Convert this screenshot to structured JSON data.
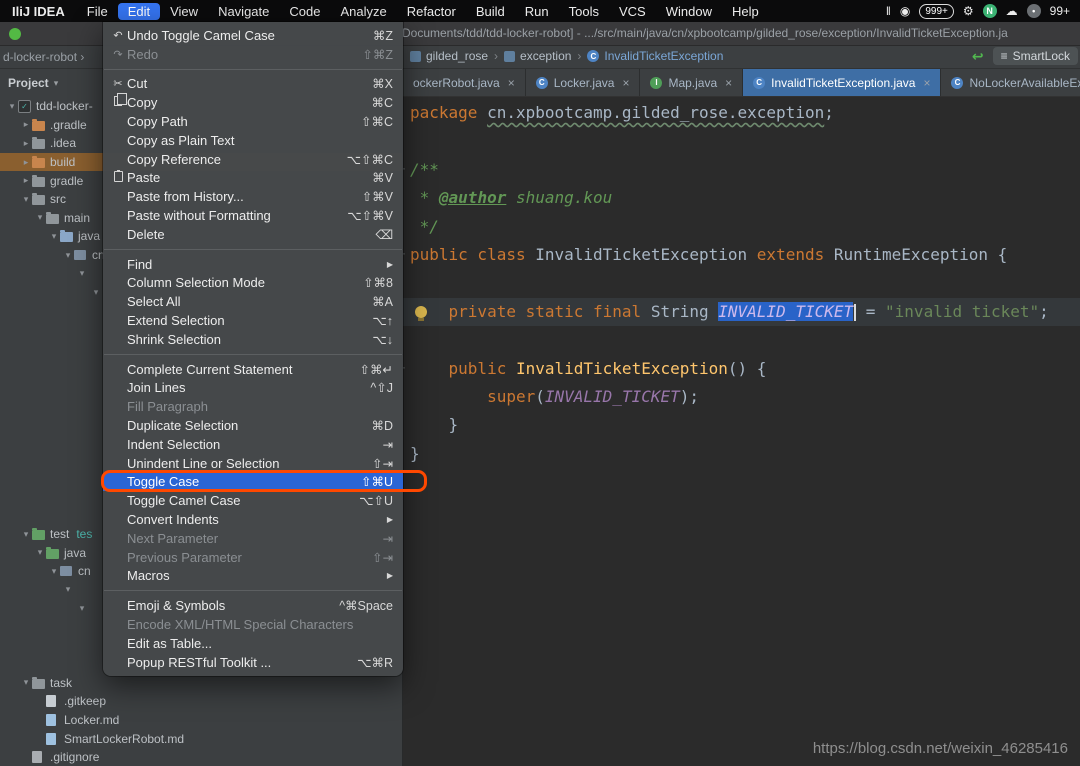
{
  "menubar": {
    "app_name": "IliJ IDEA",
    "menus": [
      "File",
      "Edit",
      "View",
      "Navigate",
      "Code",
      "Analyze",
      "Refactor",
      "Build",
      "Run",
      "Tools",
      "VCS",
      "Window",
      "Help"
    ],
    "active": "Edit",
    "status": [
      {
        "name": "pause-icon",
        "glyph": "‖"
      },
      {
        "name": "record-icon",
        "glyph": "◉"
      },
      {
        "name": "notification-badge-999",
        "glyph": "999+",
        "pill": true
      },
      {
        "name": "wrench-icon",
        "glyph": "⚙"
      },
      {
        "name": "n-circle-icon",
        "letter": "N",
        "circle": "#3bb273"
      },
      {
        "name": "cloud-icon",
        "glyph": "☁"
      },
      {
        "name": "chat-icon",
        "letter": "•",
        "circle": "#6b6f73"
      },
      {
        "name": "count-badge-99",
        "glyph": "99+"
      }
    ]
  },
  "window": {
    "title": "Documents/tdd/tdd-locker-robot] - .../src/main/java/cn/xpbootcamp/gilded_rose/exception/InvalidTicketException.ja"
  },
  "breadcrumbs": {
    "left_fragment": "d-locker-robot  ›",
    "items": [
      {
        "label": "gilded_rose",
        "icon": "package"
      },
      {
        "label": "exception",
        "icon": "package"
      },
      {
        "label": "InvalidTicketException",
        "icon": "class"
      }
    ]
  },
  "toolbar": {
    "green_arrow_glyph": "↩",
    "chip_icon": "≡",
    "chip_label": "SmartLock"
  },
  "project_panel": {
    "header": "Project",
    "header_caret": "▾",
    "rows": [
      {
        "label": "tdd-locker-",
        "indent": 0,
        "chevron": "open",
        "icon": "project"
      },
      {
        "label": ".gradle",
        "indent": 1,
        "chevron": "closed",
        "icon": "folder-excluded"
      },
      {
        "label": ".idea",
        "indent": 1,
        "chevron": "closed",
        "icon": "folder"
      },
      {
        "label": "build",
        "indent": 1,
        "chevron": "closed",
        "icon": "folder-excluded",
        "highlight": true
      },
      {
        "label": "gradle",
        "indent": 1,
        "chevron": "closed",
        "icon": "folder"
      },
      {
        "label": "src",
        "indent": 1,
        "chevron": "open",
        "icon": "folder"
      },
      {
        "label": "main",
        "indent": 2,
        "chevron": "open",
        "icon": "folder"
      },
      {
        "label": "java",
        "indent": 3,
        "chevron": "open",
        "icon": "folder-source"
      },
      {
        "label": "cn",
        "indent": 4,
        "chevron": "open",
        "icon": "package"
      },
      {
        "label": "",
        "indent": 5,
        "chevron": "open"
      },
      {
        "label": "",
        "indent": 6,
        "chevron": "open"
      },
      {
        "spacer": 12
      },
      {
        "label": "test",
        "indent": 1,
        "chevron": "open",
        "icon": "folder-test",
        "suffix": "tes"
      },
      {
        "label": "java",
        "indent": 2,
        "chevron": "open",
        "icon": "folder-test"
      },
      {
        "label": "cn",
        "indent": 3,
        "chevron": "open",
        "icon": "package"
      },
      {
        "label": "",
        "indent": 4,
        "chevron": "open"
      },
      {
        "label": "",
        "indent": 5,
        "chevron": "open"
      },
      {
        "spacer": 3
      },
      {
        "label": "task",
        "indent": 1,
        "chevron": "open",
        "icon": "folder"
      },
      {
        "label": ".gitkeep",
        "indent": 2,
        "icon": "file"
      },
      {
        "label": "Locker.md",
        "indent": 2,
        "icon": "file-md"
      },
      {
        "label": "SmartLockerRobot.md",
        "indent": 2,
        "icon": "file-md"
      },
      {
        "label": ".gitignore",
        "indent": 1,
        "icon": "file-git"
      }
    ]
  },
  "editor": {
    "tabs": [
      {
        "label": "ockerRobot.java",
        "close": true
      },
      {
        "label": "Locker.java",
        "icon": "class",
        "close": true
      },
      {
        "label": "Map.java",
        "icon": "interface",
        "close": true
      },
      {
        "label": "InvalidTicketException.java",
        "icon": "class",
        "close": true,
        "active": true
      },
      {
        "label": "NoLockerAvailableException..",
        "icon": "class"
      }
    ],
    "code_lines": [
      {
        "tokens": [
          {
            "t": "package ",
            "c": "kw"
          },
          {
            "t": "cn.xpbootcamp.gilded_rose.exception",
            "c": "pkg"
          },
          {
            "t": ";",
            "c": "pl"
          }
        ]
      },
      {
        "tokens": []
      },
      {
        "fold": true,
        "tokens": [
          {
            "t": "/**",
            "c": "doc"
          }
        ]
      },
      {
        "tokens": [
          {
            "t": " * ",
            "c": "doc"
          },
          {
            "t": "@author",
            "c": "doctag"
          },
          {
            "t": " shuang.kou",
            "c": "doc"
          }
        ]
      },
      {
        "tokens": [
          {
            "t": " */",
            "c": "doc"
          }
        ]
      },
      {
        "fold": true,
        "tokens": [
          {
            "t": "public class ",
            "c": "kw"
          },
          {
            "t": "InvalidTicketException ",
            "c": "pl"
          },
          {
            "t": "extends ",
            "c": "kw"
          },
          {
            "t": "RuntimeException ",
            "c": "pl"
          },
          {
            "t": "{",
            "c": "pl"
          }
        ]
      },
      {
        "tokens": []
      },
      {
        "highlight": true,
        "bulb": true,
        "tokens": [
          {
            "t": "    ",
            "c": "pl"
          },
          {
            "t": "private static final ",
            "c": "kw"
          },
          {
            "t": "String ",
            "c": "pl"
          },
          {
            "t": "INVALID_TICKET",
            "c": "const-sel",
            "caret": true
          },
          {
            "t": " = ",
            "c": "pl"
          },
          {
            "t": "\"invalid ticket\"",
            "c": "str"
          },
          {
            "t": ";",
            "c": "pl"
          }
        ]
      },
      {
        "tokens": []
      },
      {
        "fold": true,
        "tokens": [
          {
            "t": "    ",
            "c": "pl"
          },
          {
            "t": "public ",
            "c": "kw"
          },
          {
            "t": "InvalidTicketException",
            "c": "method"
          },
          {
            "t": "() {",
            "c": "pl"
          }
        ]
      },
      {
        "tokens": [
          {
            "t": "        ",
            "c": "pl"
          },
          {
            "t": "super",
            "c": "kw"
          },
          {
            "t": "(",
            "c": "pl"
          },
          {
            "t": "INVALID_TICKET",
            "c": "const"
          },
          {
            "t": ")",
            "c": "pl"
          },
          {
            "t": ";",
            "c": "pl"
          }
        ]
      },
      {
        "tokens": [
          {
            "t": "    }",
            "c": "pl"
          }
        ]
      },
      {
        "tokens": [
          {
            "t": "}",
            "c": "pl"
          }
        ]
      }
    ]
  },
  "edit_menu": {
    "items": [
      {
        "label": "Undo Toggle Camel Case",
        "shortcut": "⌘Z",
        "icon": "undo-icon"
      },
      {
        "label": "Redo",
        "shortcut": "⇧⌘Z",
        "icon": "redo-icon",
        "disabled": true
      },
      {
        "separator": true
      },
      {
        "label": "Cut",
        "shortcut": "⌘X",
        "icon": "cut-icon"
      },
      {
        "label": "Copy",
        "shortcut": "⌘C",
        "icon": "copy-icon"
      },
      {
        "label": "Copy Path",
        "shortcut": "⇧⌘C"
      },
      {
        "label": "Copy as Plain Text"
      },
      {
        "label": "Copy Reference",
        "shortcut": "⌥⇧⌘C"
      },
      {
        "label": "Paste",
        "shortcut": "⌘V",
        "icon": "paste-icon"
      },
      {
        "label": "Paste from History...",
        "shortcut": "⇧⌘V"
      },
      {
        "label": "Paste without Formatting",
        "shortcut": "⌥⇧⌘V"
      },
      {
        "label": "Delete",
        "shortcut": "⌫"
      },
      {
        "separator": true
      },
      {
        "label": "Find",
        "submenu": true
      },
      {
        "label": "Column Selection Mode",
        "shortcut": "⇧⌘8"
      },
      {
        "label": "Select All",
        "shortcut": "⌘A"
      },
      {
        "label": "Extend Selection",
        "shortcut": "⌥↑"
      },
      {
        "label": "Shrink Selection",
        "shortcut": "⌥↓"
      },
      {
        "separator": true
      },
      {
        "label": "Complete Current Statement",
        "shortcut": "⇧⌘↵"
      },
      {
        "label": "Join Lines",
        "shortcut": "^⇧J"
      },
      {
        "label": "Fill Paragraph",
        "disabled": true
      },
      {
        "label": "Duplicate Selection",
        "shortcut": "⌘D"
      },
      {
        "label": "Indent Selection",
        "shortcut": "⇥"
      },
      {
        "label": "Unindent Line or Selection",
        "shortcut": "⇧⇥"
      },
      {
        "label": "Toggle Case",
        "shortcut": "⇧⌘U",
        "selected": true,
        "annotated": true
      },
      {
        "label": "Toggle Camel Case",
        "shortcut": "⌥⇧U"
      },
      {
        "label": "Convert Indents",
        "submenu": true
      },
      {
        "label": "Next Parameter",
        "shortcut": "⇥",
        "disabled": true
      },
      {
        "label": "Previous Parameter",
        "shortcut": "⇧⇥",
        "disabled": true
      },
      {
        "label": "Macros",
        "submenu": true
      },
      {
        "separator": true
      },
      {
        "label": "Emoji & Symbols",
        "shortcut": "^⌘Space"
      },
      {
        "label": "Encode XML/HTML Special Characters",
        "disabled": true
      },
      {
        "label": "Edit as Table..."
      },
      {
        "label": "Popup RESTful Toolkit ...",
        "shortcut": "⌥⌘R"
      }
    ]
  },
  "watermark": "https://blog.csdn.net/weixin_46285416",
  "colors": {
    "selection_blue": "#2b65d4",
    "annotation_orange": "#ff4800",
    "active_tab_blue": "#3e6ea5",
    "keyword_orange": "#cc7832",
    "string_green": "#6a8759",
    "constant_purple": "#9876aa"
  }
}
